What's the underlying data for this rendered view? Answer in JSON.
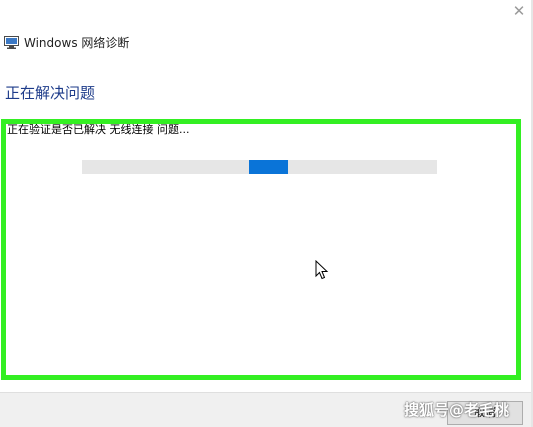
{
  "window": {
    "close_glyph": "✕",
    "app_title": "Windows 网络诊断",
    "heading": "正在解决问题",
    "status": "正在验证是否已解决 无线连接 问题..."
  },
  "progress": {
    "state": "indeterminate",
    "position_fraction": 0.47,
    "chunk_fraction": 0.11,
    "color": "#0a74d8",
    "track_color": "#e6e6e6"
  },
  "footer": {
    "cancel_label": "取消"
  },
  "watermark": {
    "text": "搜狐号@老毛桃"
  },
  "colors": {
    "heading": "#1d3b8a",
    "highlight_box": "#33ef22"
  }
}
